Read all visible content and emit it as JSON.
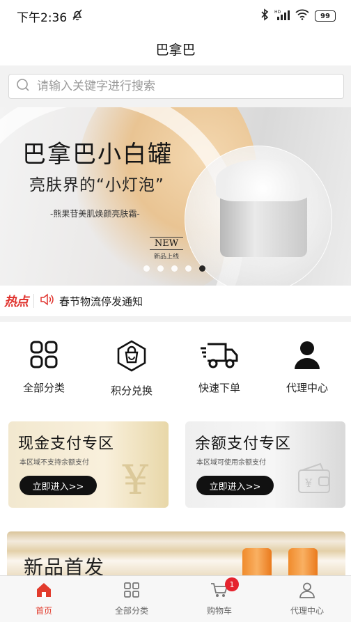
{
  "status_bar": {
    "time": "下午2:36",
    "battery": "99"
  },
  "header": {
    "title": "巴拿巴"
  },
  "search": {
    "placeholder": "请输入关键字进行搜索"
  },
  "banner": {
    "title": "巴拿巴小白罐",
    "subtitle": "亮肤界的“小灯泡”",
    "product": "-熊果苷美肌焕颜亮肤霜-",
    "new_label": "NEW",
    "new_sub": "新品上线",
    "slide_count": 5,
    "active_slide": 5
  },
  "ticker": {
    "hot_label": "热点",
    "notice": "春节物流停发通知"
  },
  "menu": [
    {
      "label": "全部分类",
      "icon": "grid-icon"
    },
    {
      "label": "积分兑换",
      "icon": "shopping-bag-icon"
    },
    {
      "label": "快速下单",
      "icon": "delivery-truck-icon"
    },
    {
      "label": "代理中心",
      "icon": "user-icon"
    }
  ],
  "zones": {
    "cash": {
      "title": "现金支付专区",
      "desc": "本区域不支持余额支付",
      "button": "立即进入>>"
    },
    "balance": {
      "title": "余额支付专区",
      "desc": "本区域可使用余额支付",
      "button": "立即进入>>"
    }
  },
  "new_section": {
    "title": "新品首发"
  },
  "tabbar": [
    {
      "label": "首页",
      "icon": "home-icon",
      "active": true
    },
    {
      "label": "全部分类",
      "icon": "grid-icon",
      "active": false
    },
    {
      "label": "购物车",
      "icon": "cart-icon",
      "active": false,
      "badge": "1"
    },
    {
      "label": "代理中心",
      "icon": "user-icon",
      "active": false
    }
  ],
  "colors": {
    "accent": "#e23b2c",
    "badge": "#e5232e",
    "button": "#111111"
  }
}
